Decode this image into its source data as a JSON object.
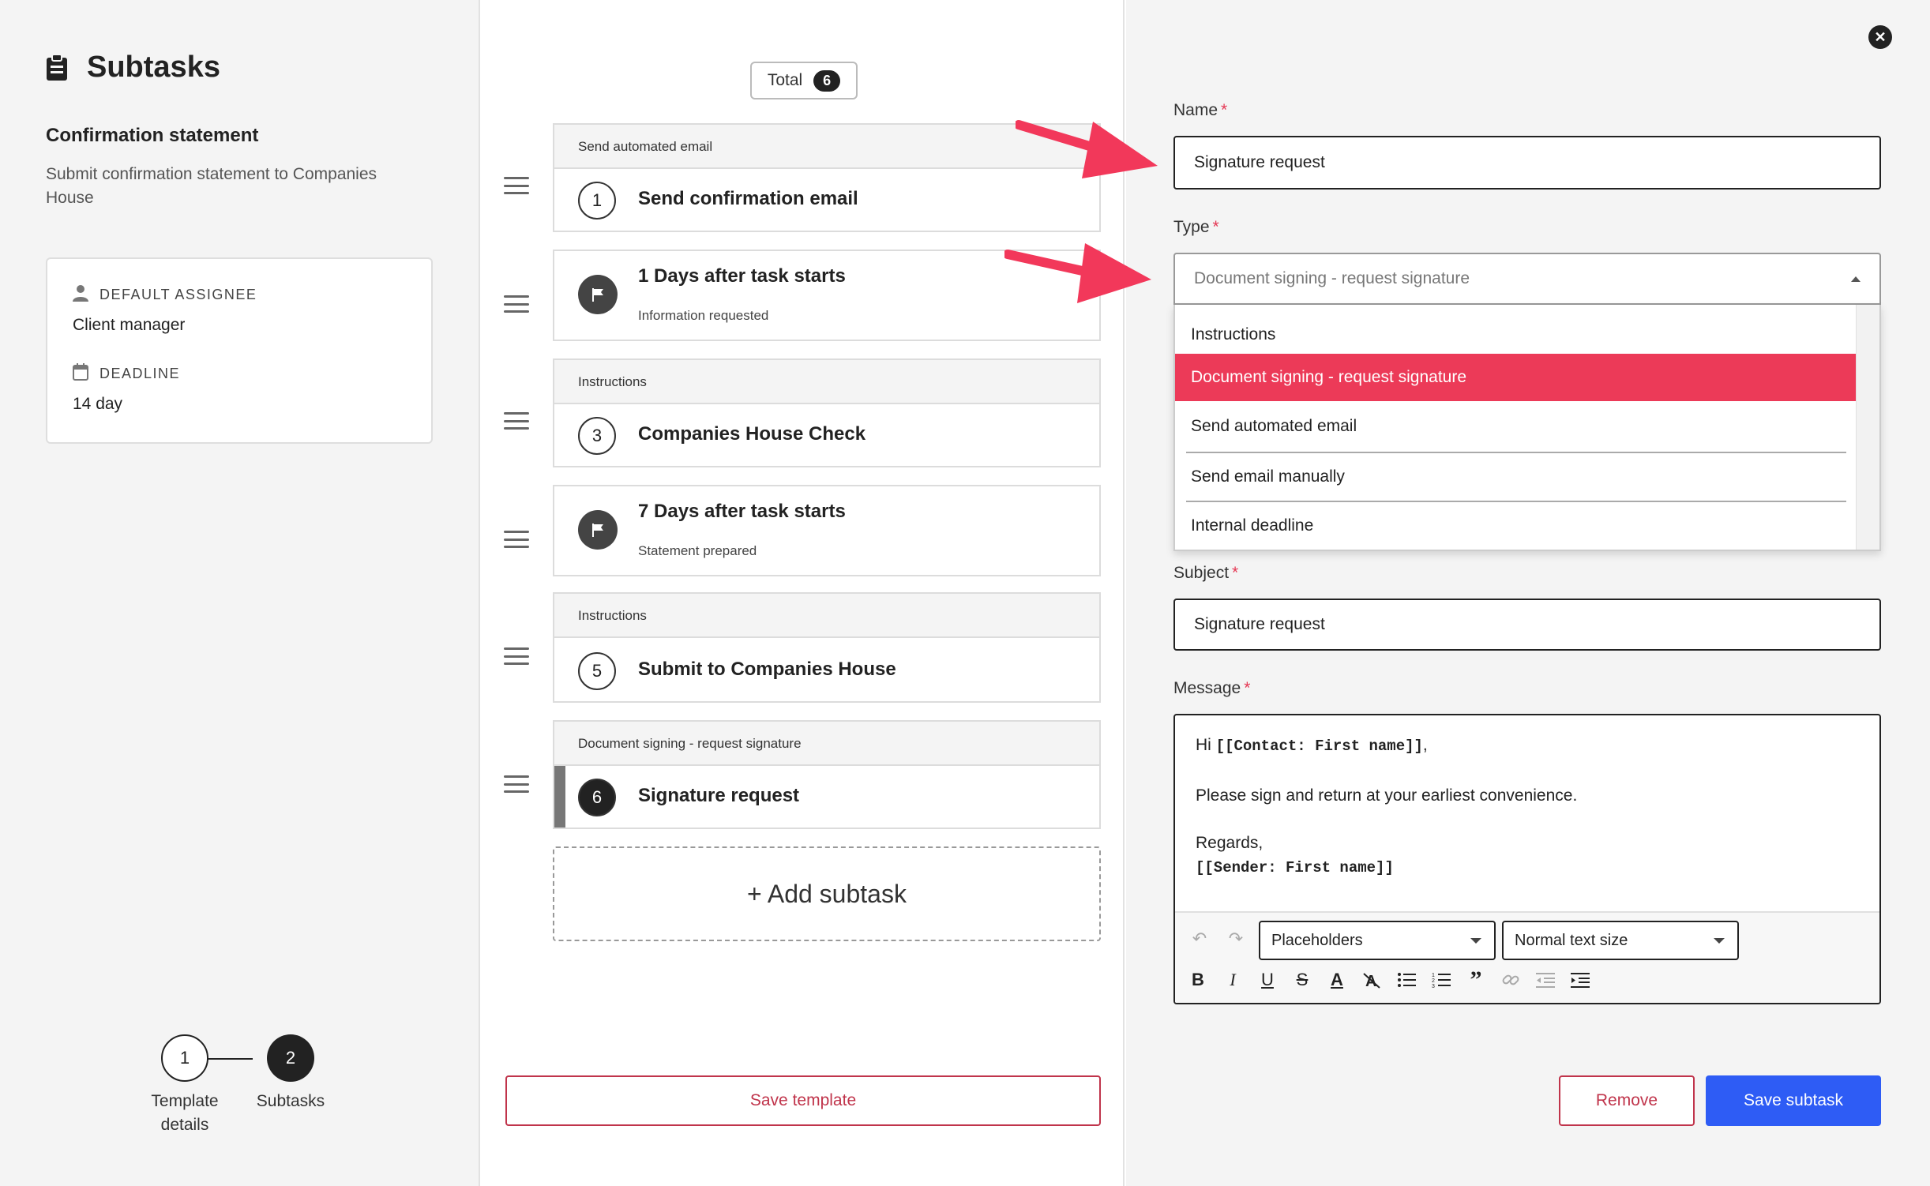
{
  "left": {
    "title": "Subtasks",
    "template_name": "Confirmation statement",
    "template_description": "Submit confirmation statement to Companies House",
    "assignee_label": "DEFAULT ASSIGNEE",
    "assignee_value": "Client manager",
    "deadline_label": "DEADLINE",
    "deadline_value": "14 day",
    "steps": [
      {
        "number": "1",
        "label": "Template details"
      },
      {
        "number": "2",
        "label": "Subtasks"
      }
    ]
  },
  "middle": {
    "total_label": "Total",
    "total_count": "6",
    "subtasks": [
      {
        "type": "Send automated email",
        "number": "1",
        "title": "Send confirmation email"
      },
      {
        "title": "1 Days after task starts",
        "subtitle": "Information requested"
      },
      {
        "type": "Instructions",
        "number": "3",
        "title": "Companies House Check"
      },
      {
        "title": "7 Days after task starts",
        "subtitle": "Statement prepared"
      },
      {
        "type": "Instructions",
        "number": "5",
        "title": "Submit to Companies House"
      },
      {
        "type": "Document signing - request signature",
        "number": "6",
        "title": "Signature request"
      }
    ],
    "add_subtask_label": "+ Add subtask",
    "save_template_label": "Save template"
  },
  "right": {
    "name_label": "Name",
    "name_value": "Signature request",
    "type_label": "Type",
    "type_value": "Document signing - request signature",
    "type_options": [
      "Instructions",
      "Document signing - request signature",
      "Send automated email",
      "Send email manually",
      "Internal deadline"
    ],
    "subject_label": "Subject",
    "subject_value": "Signature request",
    "message_label": "Message",
    "message": {
      "greeting": "Hi ",
      "greeting_placeholder": "[[Contact: First name]]",
      "greeting_end": ",",
      "body": "Please sign and return at your earliest convenience.",
      "signoff": "Regards,",
      "sender_placeholder": "[[Sender: First name]]"
    },
    "toolbar": {
      "placeholders_label": "Placeholders",
      "text_size_label": "Normal text size"
    },
    "required_mark": "*",
    "remove_label": "Remove",
    "save_subtask_label": "Save subtask"
  },
  "colors": {
    "accent_red": "#ec3a58",
    "primary_blue": "#2e5cf5",
    "danger_outline": "#c0344b"
  }
}
